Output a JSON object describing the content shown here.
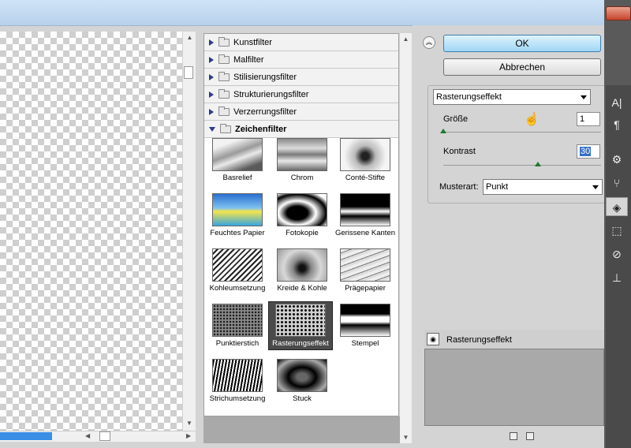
{
  "filter_gallery": {
    "categories": [
      {
        "label": "Kunstfilter",
        "expanded": false
      },
      {
        "label": "Malfilter",
        "expanded": false
      },
      {
        "label": "Stilisierungsfilter",
        "expanded": false
      },
      {
        "label": "Strukturierungsfilter",
        "expanded": false
      },
      {
        "label": "Verzerrungsfilter",
        "expanded": false
      },
      {
        "label": "Zeichenfilter",
        "expanded": true
      }
    ],
    "thumbnails": [
      {
        "label": "Basrelief"
      },
      {
        "label": "Chrom"
      },
      {
        "label": "Conté-Stifte"
      },
      {
        "label": "Feuchtes Papier"
      },
      {
        "label": "Fotokopie"
      },
      {
        "label": "Gerissene Kanten"
      },
      {
        "label": "Kohleumsetzung"
      },
      {
        "label": "Kreide & Kohle"
      },
      {
        "label": "Prägepapier"
      },
      {
        "label": "Punktierstich"
      },
      {
        "label": "Rasterungseffekt",
        "selected": true
      },
      {
        "label": "Stempel"
      },
      {
        "label": "Strichumsetzung"
      },
      {
        "label": "Stuck"
      }
    ]
  },
  "controls": {
    "ok_label": "OK",
    "cancel_label": "Abbrechen",
    "collapse_icon": "chevron-up-double-icon",
    "filter_select": "Rasterungseffekt",
    "size_label": "Größe",
    "size_value": "1",
    "size_fraction": 0.0,
    "contrast_label": "Kontrast",
    "contrast_value": "30",
    "contrast_fraction": 0.6,
    "pattern_label": "Musterart:",
    "pattern_value": "Punkt"
  },
  "effect_layers": {
    "items": [
      {
        "label": "Rasterungseffekt",
        "visible": true
      }
    ]
  },
  "colors": {
    "ok_button": "#9fd6f5",
    "slider_knob": "#1e7a2e",
    "selection": "#4a4a4a"
  }
}
